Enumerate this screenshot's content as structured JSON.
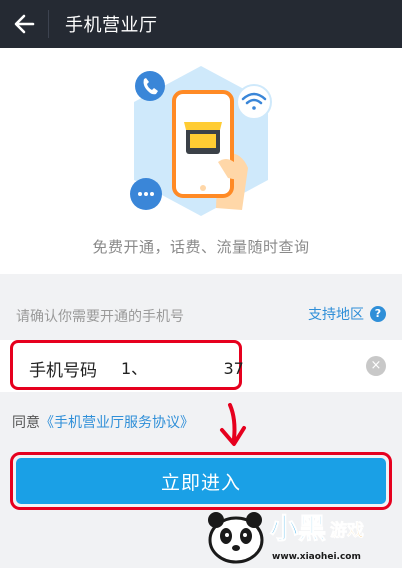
{
  "header": {
    "title": "手机营业厅",
    "back_icon": "arrow-left-icon"
  },
  "hero": {
    "tagline": "免费开通，话费、流量随时查询",
    "illustration_icons": [
      "phone-icon",
      "wifi-icon",
      "chat-bubble-icon",
      "store-icon"
    ]
  },
  "form": {
    "prompt": "请确认你需要开通的手机号",
    "region_link": "支持地区",
    "help_icon": "?",
    "phone_label": "手机号码",
    "phone_value": "1、               37",
    "clear_icon": "×"
  },
  "agreement": {
    "prefix": "同意",
    "link": "《手机营业厅服务协议》"
  },
  "enter_button": {
    "label": "立即进入"
  },
  "colors": {
    "topbar": "#252a33",
    "accent_blue": "#1aa0e6",
    "link_blue": "#2f8fd8",
    "annotation_red": "#e6001e"
  },
  "watermark": {
    "brand_text": "小黑游戏",
    "site": "www.xiaohei.com"
  }
}
